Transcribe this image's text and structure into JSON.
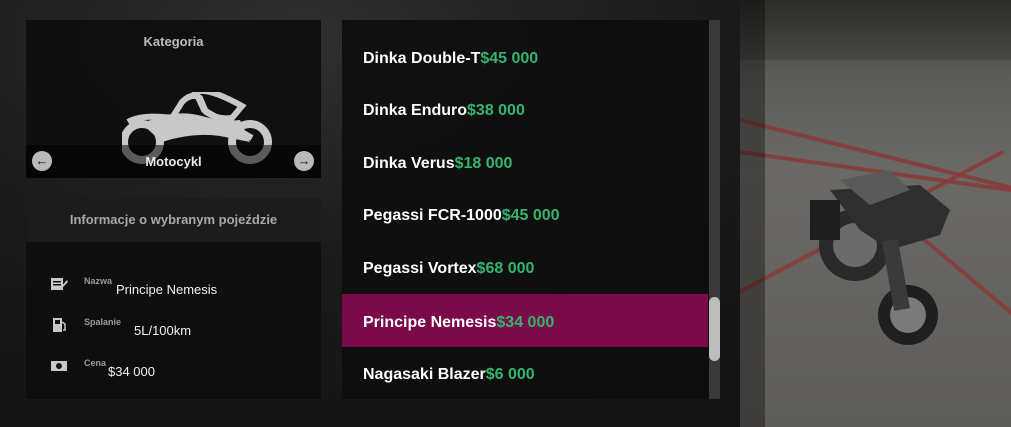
{
  "category": {
    "title": "Kategoria",
    "name": "Motocykl",
    "prev_icon": "arrow-left-icon",
    "next_icon": "arrow-right-icon",
    "icon": "motorcycle-icon"
  },
  "info": {
    "title": "Informacje o wybranym pojeździe",
    "rows": [
      {
        "icon": "edit-icon",
        "label": "Nazwa",
        "value": "Principe Nemesis"
      },
      {
        "icon": "fuel-icon",
        "label": "Spalanie",
        "value": "5L/100km"
      },
      {
        "icon": "money-icon",
        "label": "Cena",
        "value": "$34 000"
      }
    ]
  },
  "vehicles": [
    {
      "name": "Dinka Double-T",
      "price": "$45 000"
    },
    {
      "name": "Dinka Enduro",
      "price": "$38 000"
    },
    {
      "name": "Dinka Verus",
      "price": "$18 000"
    },
    {
      "name": "Pegassi FCR-1000",
      "price": "$45 000"
    },
    {
      "name": "Pegassi Vortex",
      "price": "$68 000"
    },
    {
      "name": "Principe Nemesis",
      "price": "$34 000",
      "selected": true
    },
    {
      "name": "Nagasaki Blazer",
      "price": "$6 000"
    }
  ],
  "colors": {
    "selected_row": "#7b0a4b",
    "price": "#35b46f"
  }
}
